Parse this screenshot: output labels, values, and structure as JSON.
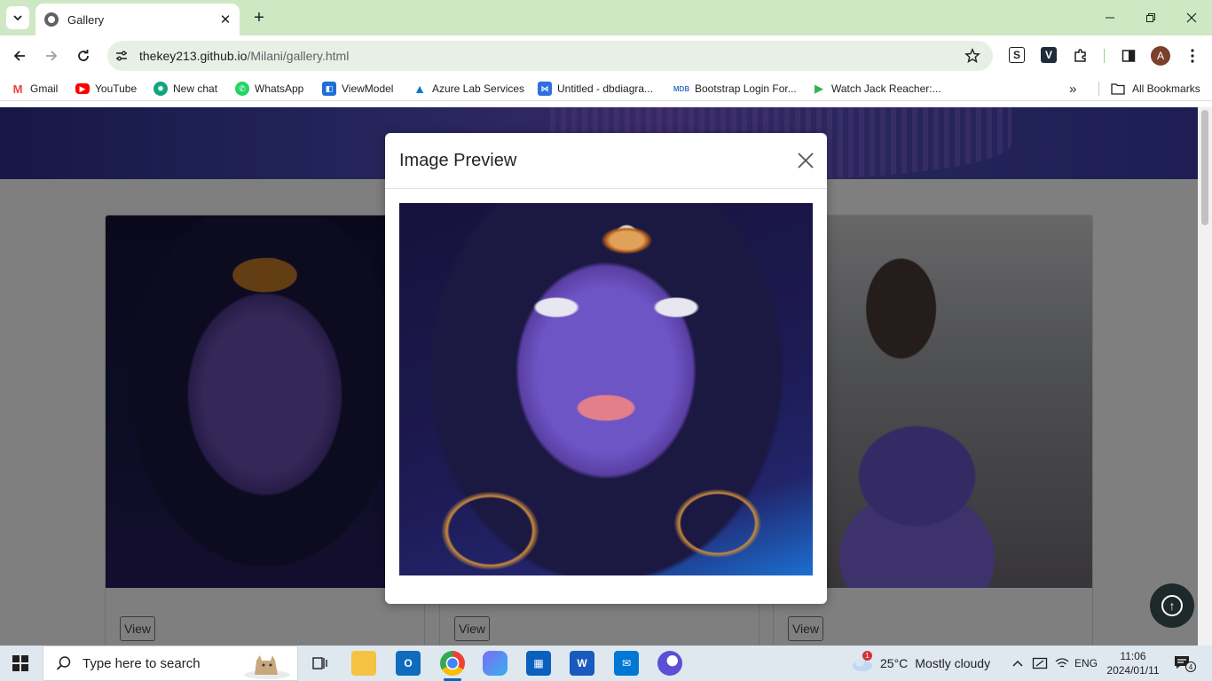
{
  "browser": {
    "tab_title": "Gallery",
    "url_host": "thekey213.github.io",
    "url_path": "/Milani/gallery.html",
    "avatar_letter": "A",
    "extensions": [
      "S",
      "V"
    ]
  },
  "bookmarks": {
    "items": [
      {
        "label": "Gmail",
        "icon": "gmail-icon",
        "color": "#ea4335"
      },
      {
        "label": "YouTube",
        "icon": "youtube-icon",
        "color": "#ff0000"
      },
      {
        "label": "New chat",
        "icon": "chatgpt-icon",
        "color": "#10a37f"
      },
      {
        "label": "WhatsApp",
        "icon": "whatsapp-icon",
        "color": "#25d366"
      },
      {
        "label": "ViewModel",
        "icon": "viewmodel-icon",
        "color": "#1e6fd9"
      },
      {
        "label": "Azure Lab Services",
        "icon": "azure-icon",
        "color": "#0078d4"
      },
      {
        "label": "Untitled - dbdiagra...",
        "icon": "dbdiagram-icon",
        "color": "#2f6fe0"
      },
      {
        "label": "Bootstrap Login For...",
        "icon": "mdb-icon",
        "color": "#3b71ca"
      },
      {
        "label": "Watch Jack Reacher:...",
        "icon": "play-icon",
        "color": "#33b14a"
      }
    ],
    "all_bookmarks": "All Bookmarks"
  },
  "gallery": {
    "view_label": "View"
  },
  "modal": {
    "title": "Image Preview"
  },
  "taskbar": {
    "search_placeholder": "Type here to search",
    "weather_temp": "25°C",
    "weather_text": "Mostly cloudy",
    "weather_badge": "1",
    "language": "ENG",
    "time": "11:06",
    "date": "2024/01/11",
    "notification_count": "4"
  },
  "colors": {
    "tabstrip": "#cfe8c4",
    "overlay": "rgba(0,0,0,0.5)",
    "accent": "#0067c0"
  }
}
